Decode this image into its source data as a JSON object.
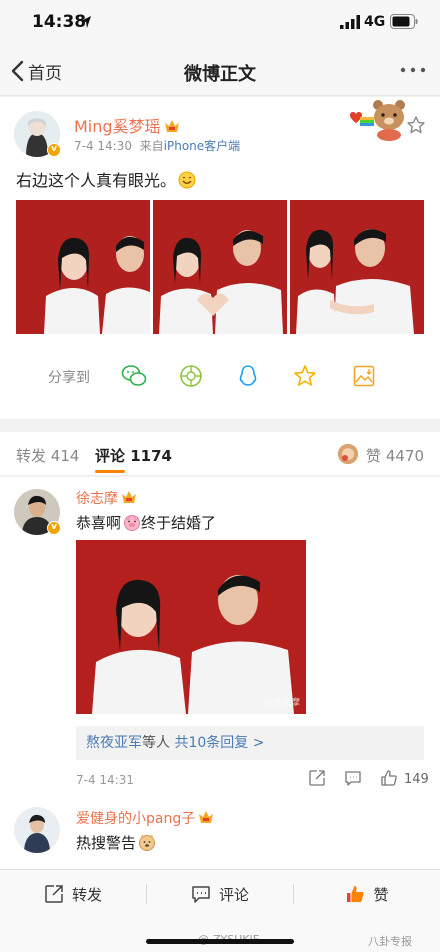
{
  "status_bar": {
    "time": "14:38",
    "network": "4G"
  },
  "nav": {
    "back_label": "首页",
    "title": "微博正文"
  },
  "post": {
    "username": "Ming奚梦瑶",
    "time": "7-4 14:30",
    "source_prefix": "来自",
    "source": "iPhone客户端",
    "text": "右边这个人真有眼光。",
    "share_label": "分享到"
  },
  "tabs": {
    "repost_label": "转发",
    "repost_count": "414",
    "comment_label": "评论",
    "comment_count": "1174",
    "like_label": "赞",
    "like_count": "4470"
  },
  "comments": [
    {
      "username": "徐志摩",
      "text_before": "恭喜啊",
      "text_after": "终于结婚了",
      "photo_watermark": "@徐志摩",
      "reply_users": "熬夜亚军",
      "reply_mid": "等人",
      "reply_link": "共10条回复 >",
      "time": "7-4 14:31",
      "likes": "149"
    },
    {
      "username": "爱健身的小pang子",
      "text": "热搜警告"
    }
  ],
  "toolbar": {
    "repost": "转发",
    "comment": "评论",
    "like": "赞"
  },
  "watermark": {
    "left": "@-ZYSUKIE-",
    "right": "八卦专报"
  },
  "colors": {
    "accent_orange": "#ff8200",
    "username": "#eb7350",
    "link_blue": "#4a7bb4",
    "photo_red": "#b0201e"
  }
}
